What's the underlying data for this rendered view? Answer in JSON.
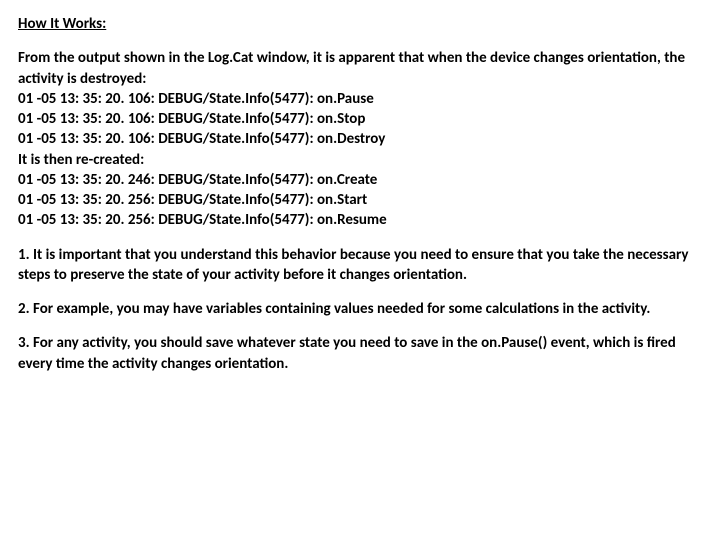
{
  "heading": "How It Works:",
  "intro": "From the output shown in the Log.Cat window, it is apparent that when the device changes orientation, the activity is destroyed:",
  "log1": [
    "01 -05 13: 35: 20. 106: DEBUG/State.Info(5477): on.Pause",
    "01 -05 13: 35: 20. 106: DEBUG/State.Info(5477): on.Stop",
    "01 -05 13: 35: 20. 106: DEBUG/State.Info(5477): on.Destroy"
  ],
  "mid": "It is then re-created:",
  "log2": [
    "01 -05 13: 35: 20. 246: DEBUG/State.Info(5477): on.Create",
    "01 -05 13: 35: 20. 256: DEBUG/State.Info(5477): on.Start",
    "01 -05 13: 35: 20. 256: DEBUG/State.Info(5477): on.Resume"
  ],
  "points": [
    "1. It is important that you understand this behavior because you need to ensure that you take the necessary steps to preserve the state of your activity before it changes orientation.",
    "2. For example, you may have variables containing values needed for some calculations in the activity.",
    "3. For any activity, you should save whatever state you need to save in the on.Pause() event, which is fired every time the activity changes orientation."
  ]
}
